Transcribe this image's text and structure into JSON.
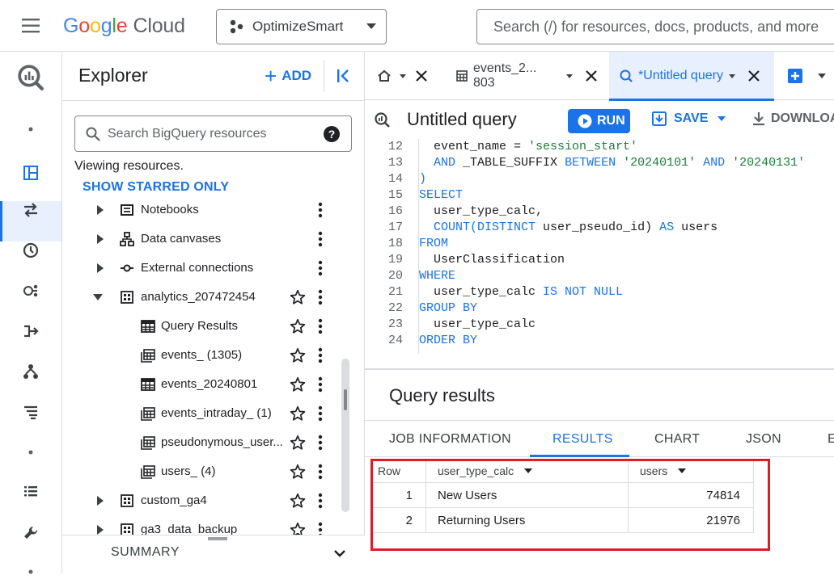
{
  "header": {
    "logo_google": "Google",
    "logo_cloud": "Cloud",
    "project": "OptimizeSmart",
    "search_placeholder": "Search (/) for resources, docs, products, and more"
  },
  "explorer": {
    "title": "Explorer",
    "add_label": "ADD",
    "search_placeholder": "Search BigQuery resources",
    "help": "?",
    "viewing": "Viewing resources.",
    "show_starred": "SHOW STARRED ONLY",
    "tree": [
      {
        "label": "Notebooks",
        "icon": "notebook-icon",
        "level": 0
      },
      {
        "label": "Data canvases",
        "icon": "canvas-icon",
        "level": 0
      },
      {
        "label": "External connections",
        "icon": "connection-icon",
        "level": 0
      },
      {
        "label": "analytics_207472454",
        "icon": "dataset-icon",
        "level": 0,
        "expanded": true
      },
      {
        "label": "Query Results",
        "icon": "table-icon",
        "level": 1
      },
      {
        "label": "events_ (1305)",
        "icon": "sharded-table-icon",
        "level": 1
      },
      {
        "label": "events_20240801",
        "icon": "table-icon",
        "level": 1
      },
      {
        "label": "events_intraday_ (1)",
        "icon": "sharded-table-icon",
        "level": 1
      },
      {
        "label": "pseudonymous_user...",
        "icon": "sharded-table-icon",
        "level": 1
      },
      {
        "label": "users_ (4)",
        "icon": "sharded-table-icon",
        "level": 1
      },
      {
        "label": "custom_ga4",
        "icon": "dataset-icon",
        "level": 0
      },
      {
        "label": "ga3_data_backup",
        "icon": "dataset-icon",
        "level": 0
      }
    ],
    "summary": "SUMMARY"
  },
  "tabs": [
    {
      "label": "",
      "icon": "home-icon"
    },
    {
      "label": "events_2... 803",
      "icon": "table-icon"
    },
    {
      "label": "*Untitled query",
      "icon": "query-icon",
      "active": true
    }
  ],
  "query": {
    "title": "Untitled query",
    "run": "RUN",
    "save": "SAVE",
    "download": "DOWNLOAD"
  },
  "code_lines": [
    {
      "n": "12",
      "html": "  event_name = <span class=\"st\">'session_start'</span>"
    },
    {
      "n": "13",
      "html": "  <span class=\"kw\">AND</span> _TABLE_SUFFIX <span class=\"kw\">BETWEEN</span> <span class=\"st\">'20240101'</span> <span class=\"kw\">AND</span> <span class=\"st\">'20240131'</span>"
    },
    {
      "n": "14",
      "html": "<span class=\"kw\">)</span>"
    },
    {
      "n": "15",
      "html": "<span class=\"kw\">SELECT</span>"
    },
    {
      "n": "16",
      "html": "  user_type_calc,"
    },
    {
      "n": "17",
      "html": "  <span class=\"kw\">COUNT(DISTINCT</span> user_pseudo_id) <span class=\"kw\">AS</span> users"
    },
    {
      "n": "18",
      "html": "<span class=\"kw\">FROM</span>"
    },
    {
      "n": "19",
      "html": "  UserClassification"
    },
    {
      "n": "20",
      "html": "<span class=\"kw\">WHERE</span>"
    },
    {
      "n": "21",
      "html": "  user_type_calc <span class=\"kw\">IS NOT NULL</span>"
    },
    {
      "n": "22",
      "html": "<span class=\"kw\">GROUP BY</span>"
    },
    {
      "n": "23",
      "html": "  user_type_calc"
    },
    {
      "n": "24",
      "html": "<span class=\"kw\">ORDER BY</span>"
    }
  ],
  "results": {
    "title": "Query results",
    "tabs": [
      "JOB INFORMATION",
      "RESULTS",
      "CHART",
      "JSON",
      "E"
    ],
    "columns": [
      "Row",
      "user_type_calc",
      "users"
    ],
    "rows": [
      {
        "row": "1",
        "user_type_calc": "New Users",
        "users": "74814"
      },
      {
        "row": "2",
        "user_type_calc": "Returning Users",
        "users": "21976"
      }
    ]
  },
  "colors": {
    "accent": "#1a73e8",
    "highlight": "#e01b24"
  }
}
